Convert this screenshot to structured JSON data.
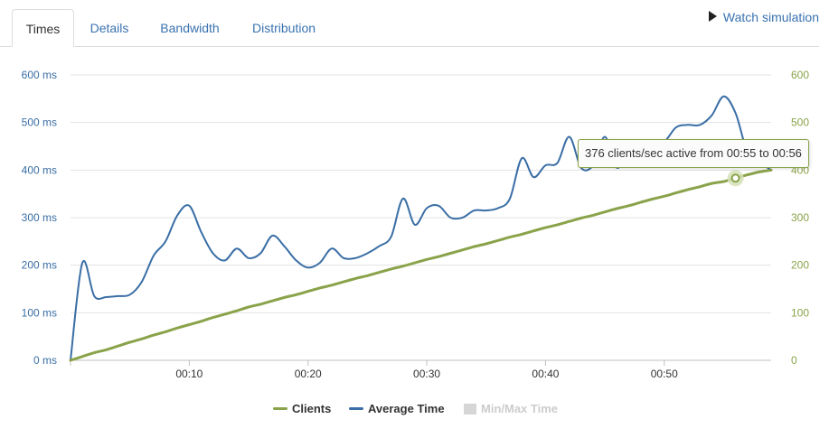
{
  "tabs": [
    {
      "label": "Times",
      "active": true
    },
    {
      "label": "Details",
      "active": false
    },
    {
      "label": "Bandwidth",
      "active": false
    },
    {
      "label": "Distribution",
      "active": false
    }
  ],
  "watch_simulation": {
    "label": "Watch simulation",
    "icon": "play-icon"
  },
  "tooltip": {
    "text": "376 clients/sec active from 00:55 to 00:56"
  },
  "legend": [
    {
      "label": "Clients",
      "color": "#8aa34a",
      "enabled": true
    },
    {
      "label": "Average Time",
      "color": "#3a6ea5",
      "enabled": true
    },
    {
      "label": "Min/Max Time",
      "color": "#cccccc",
      "enabled": false
    }
  ],
  "chart_data": {
    "type": "line",
    "x": [
      0,
      1,
      2,
      3,
      4,
      5,
      6,
      7,
      8,
      9,
      10,
      11,
      12,
      13,
      14,
      15,
      16,
      17,
      18,
      19,
      20,
      21,
      22,
      23,
      24,
      25,
      26,
      27,
      28,
      29,
      30,
      31,
      32,
      33,
      34,
      35,
      36,
      37,
      38,
      39,
      40,
      41,
      42,
      43,
      44,
      45,
      46,
      47,
      48,
      49,
      50,
      51,
      52,
      53,
      54,
      55,
      56,
      57,
      58,
      59
    ],
    "x_tick_values": [
      10,
      20,
      30,
      40,
      50
    ],
    "x_tick_labels": [
      "00:10",
      "00:20",
      "00:30",
      "00:40",
      "00:50"
    ],
    "xlim": [
      0,
      59
    ],
    "y_left": {
      "ylim": [
        0,
        600
      ],
      "ticks": [
        0,
        100,
        200,
        300,
        400,
        500,
        600
      ],
      "tick_labels": [
        "0 ms",
        "100 ms",
        "200 ms",
        "300 ms",
        "400 ms",
        "500 ms",
        "600 ms"
      ],
      "color": "#3a6ea5"
    },
    "y_right": {
      "ylim": [
        0,
        600
      ],
      "ticks": [
        0,
        100,
        200,
        300,
        400,
        500,
        600
      ],
      "tick_labels": [
        "0",
        "100",
        "200",
        "300",
        "400",
        "500",
        "600"
      ],
      "color": "#8aa34a"
    },
    "grid": true,
    "legend_position": "bottom-center",
    "series": [
      {
        "name": "Clients",
        "axis": "right",
        "color": "#8aa34a",
        "values": [
          0,
          8,
          16,
          22,
          30,
          38,
          45,
          53,
          60,
          68,
          75,
          82,
          90,
          97,
          104,
          112,
          118,
          125,
          132,
          138,
          145,
          152,
          158,
          165,
          172,
          178,
          185,
          192,
          198,
          205,
          212,
          218,
          225,
          232,
          239,
          245,
          252,
          259,
          265,
          272,
          279,
          285,
          292,
          299,
          305,
          312,
          319,
          325,
          332,
          339,
          345,
          352,
          359,
          365,
          372,
          376,
          383,
          390,
          396,
          400
        ]
      },
      {
        "name": "Average Time",
        "axis": "left",
        "color": "#3a6ea5",
        "values": [
          0,
          205,
          135,
          133,
          135,
          138,
          165,
          220,
          250,
          305,
          325,
          270,
          225,
          210,
          235,
          215,
          225,
          262,
          240,
          210,
          195,
          205,
          235,
          215,
          215,
          225,
          240,
          260,
          340,
          285,
          320,
          325,
          300,
          300,
          315,
          315,
          320,
          340,
          425,
          385,
          410,
          415,
          470,
          405,
          410,
          470,
          405,
          440,
          450,
          460,
          460,
          490,
          495,
          495,
          515,
          555,
          520,
          438,
          417,
          400
        ]
      }
    ],
    "highlight": {
      "series": "Clients",
      "x": 56
    }
  }
}
